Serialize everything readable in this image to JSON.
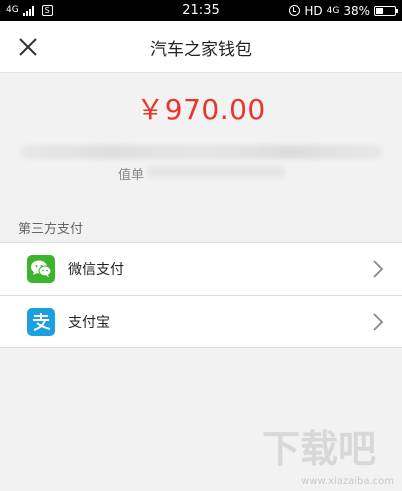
{
  "status_bar": {
    "network": "4G",
    "sim_icon": "S",
    "time": "21:35",
    "right_text": "HD",
    "right_network": "4G",
    "battery": "38%"
  },
  "header": {
    "title": "汽车之家钱包",
    "close_icon": "close-icon"
  },
  "payment": {
    "amount": "￥970.00",
    "order_label": "值单"
  },
  "third_party": {
    "section_title": "第三方支付",
    "methods": [
      {
        "label": "微信支付",
        "icon": "wechat-icon",
        "color": "#3bb42f"
      },
      {
        "label": "支付宝",
        "icon": "alipay-icon",
        "color": "#1a9fe0"
      }
    ]
  },
  "watermark": {
    "logo_text": "下载吧",
    "url": "www.xiazaiba.com"
  }
}
